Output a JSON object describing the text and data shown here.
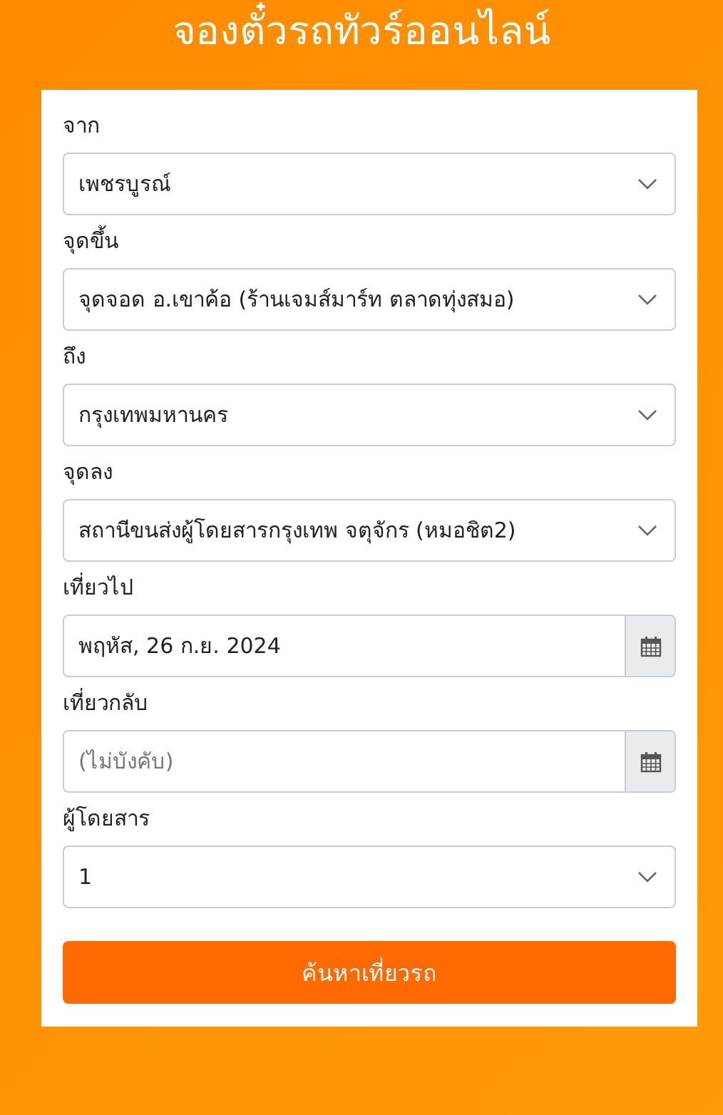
{
  "title": "จองตั๋วรถทัวร์ออนไลน์",
  "fields": [
    {
      "kind": "select",
      "label": "จาก",
      "value": "เพชรบูรณ์"
    },
    {
      "kind": "select",
      "label": "จุดขึ้น",
      "value": "จุดจอด อ.เขาค้อ (ร้านเจมส์มาร์ท ตลาดทุ่งสมอ)"
    },
    {
      "kind": "select",
      "label": "ถึง",
      "value": "กรุงเทพมหานคร"
    },
    {
      "kind": "select",
      "label": "จุดลง",
      "value": "สถานีขนส่งผู้โดยสารกรุงเทพ จตุจักร (หมอชิต2)"
    },
    {
      "kind": "date",
      "label": "เที่ยวไป",
      "value": "พฤหัส, 26 ก.ย. 2024"
    },
    {
      "kind": "date",
      "label": "เที่ยวกลับ",
      "placeholder": "(ไม่บังคับ)"
    },
    {
      "kind": "select",
      "label": "ผู้โดยสาร",
      "value": "1"
    }
  ],
  "button": "ค้นหาเที่ยวรถ"
}
